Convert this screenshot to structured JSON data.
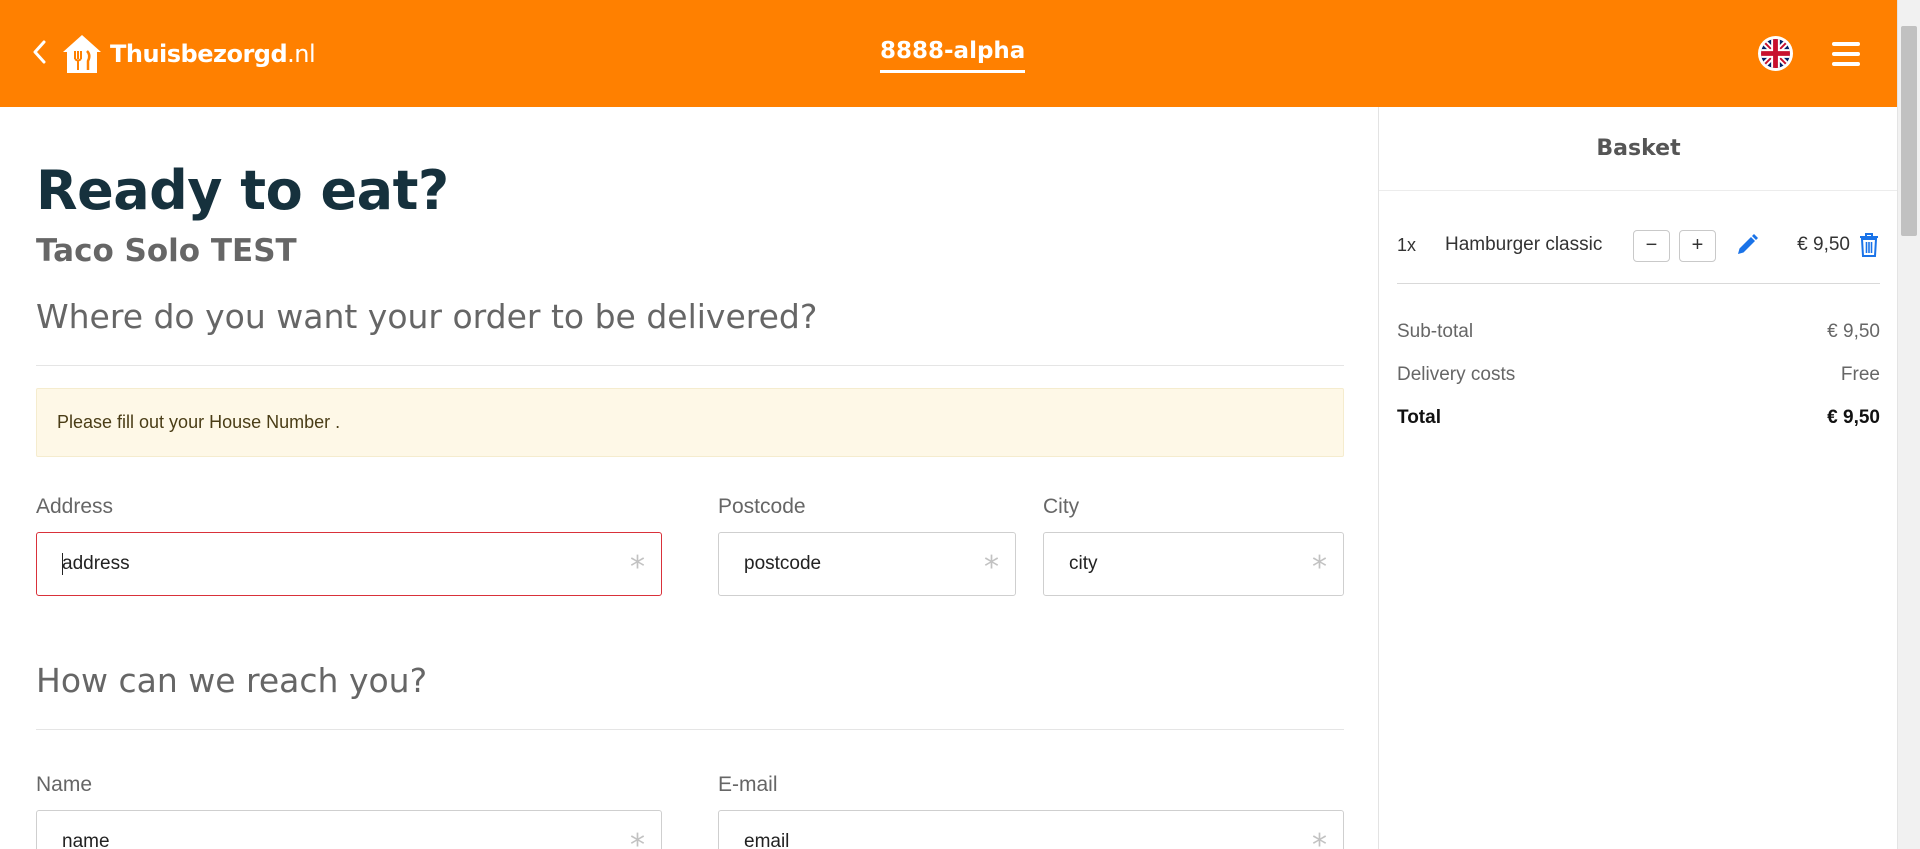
{
  "header": {
    "back_icon": "chevron-left-icon",
    "logo_text": "Thuisbezorgd",
    "logo_tld": ".nl",
    "center_link": "8888-alpha",
    "language_icon": "uk-flag-icon",
    "menu_icon": "hamburger-menu-icon",
    "brand_color": "#ff8000"
  },
  "main": {
    "title": "Ready to eat?",
    "restaurant": "Taco Solo TEST",
    "delivery_heading": "Where do you want your order to be delivered?",
    "alert_text": "Please fill out your House Number .",
    "fields": {
      "address": {
        "label": "Address",
        "placeholder": "address",
        "required": "*"
      },
      "postcode": {
        "label": "Postcode",
        "placeholder": "postcode",
        "required": "*"
      },
      "city": {
        "label": "City",
        "placeholder": "city",
        "required": "*"
      },
      "name": {
        "label": "Name",
        "placeholder": "name",
        "required": "*"
      },
      "email": {
        "label": "E-mail",
        "placeholder": "email",
        "required": "*"
      }
    },
    "contact_heading": "How can we reach you?"
  },
  "basket": {
    "title": "Basket",
    "items": [
      {
        "qty": "1x",
        "name": "Hamburger classic",
        "decrease": "−",
        "increase": "+",
        "price": "€ 9,50"
      }
    ],
    "subtotal_label": "Sub-total",
    "subtotal_value": "€ 9,50",
    "delivery_label": "Delivery costs",
    "delivery_value": "Free",
    "total_label": "Total",
    "total_value": "€ 9,50",
    "accent_color": "#1a73e8"
  }
}
